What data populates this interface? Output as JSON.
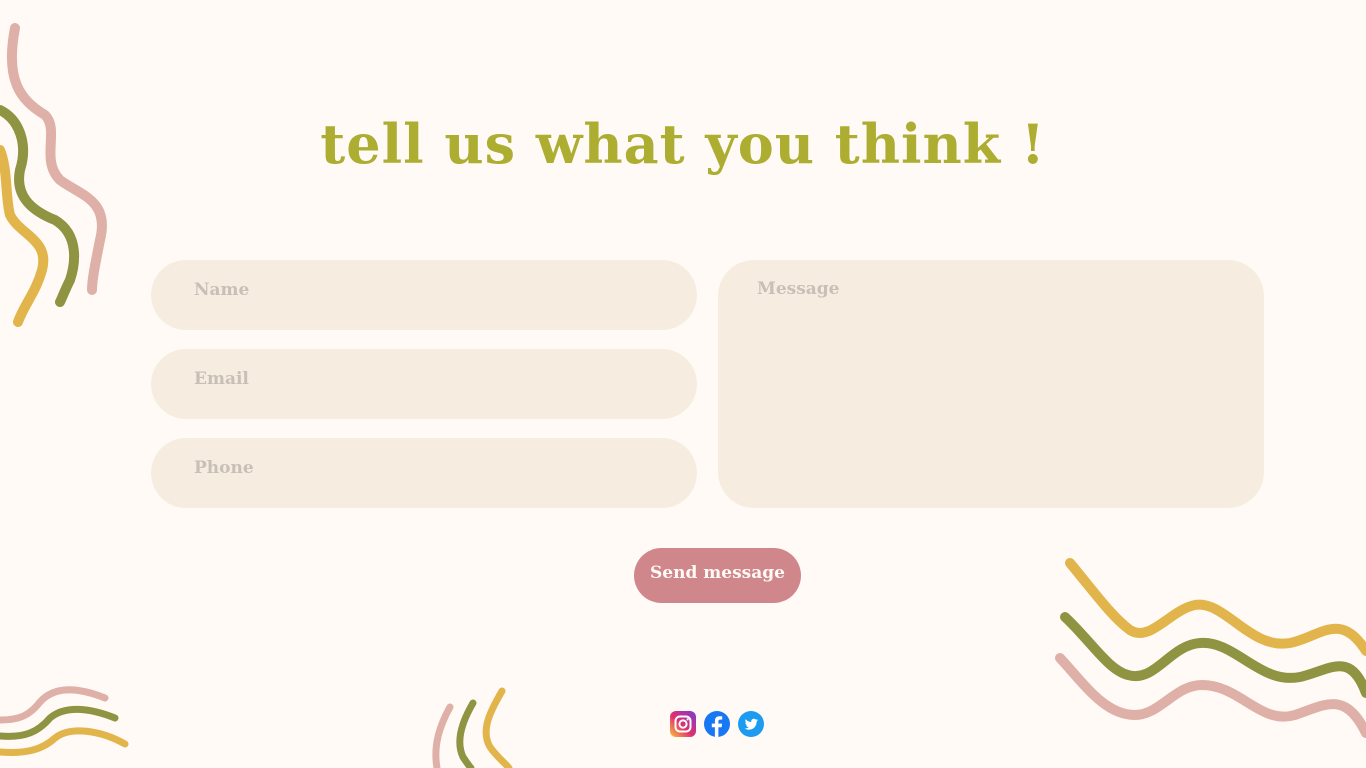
{
  "colors": {
    "accent": "#adad31",
    "background": "#fffaf5",
    "field": "#f6ede0",
    "placeholder": "#c8bfb6",
    "button": "#d0878b",
    "deco_pink": "#dfb0a8",
    "deco_olive": "#8f9442",
    "deco_mustard": "#e1b54c"
  },
  "header": {
    "title": "tell us what you think !"
  },
  "form": {
    "name_placeholder": "Name",
    "email_placeholder": "Email",
    "phone_placeholder": "Phone",
    "message_placeholder": "Message",
    "submit_label": "Send message"
  },
  "social": {
    "icons": [
      "instagram-icon",
      "facebook-icon",
      "twitter-icon"
    ]
  }
}
